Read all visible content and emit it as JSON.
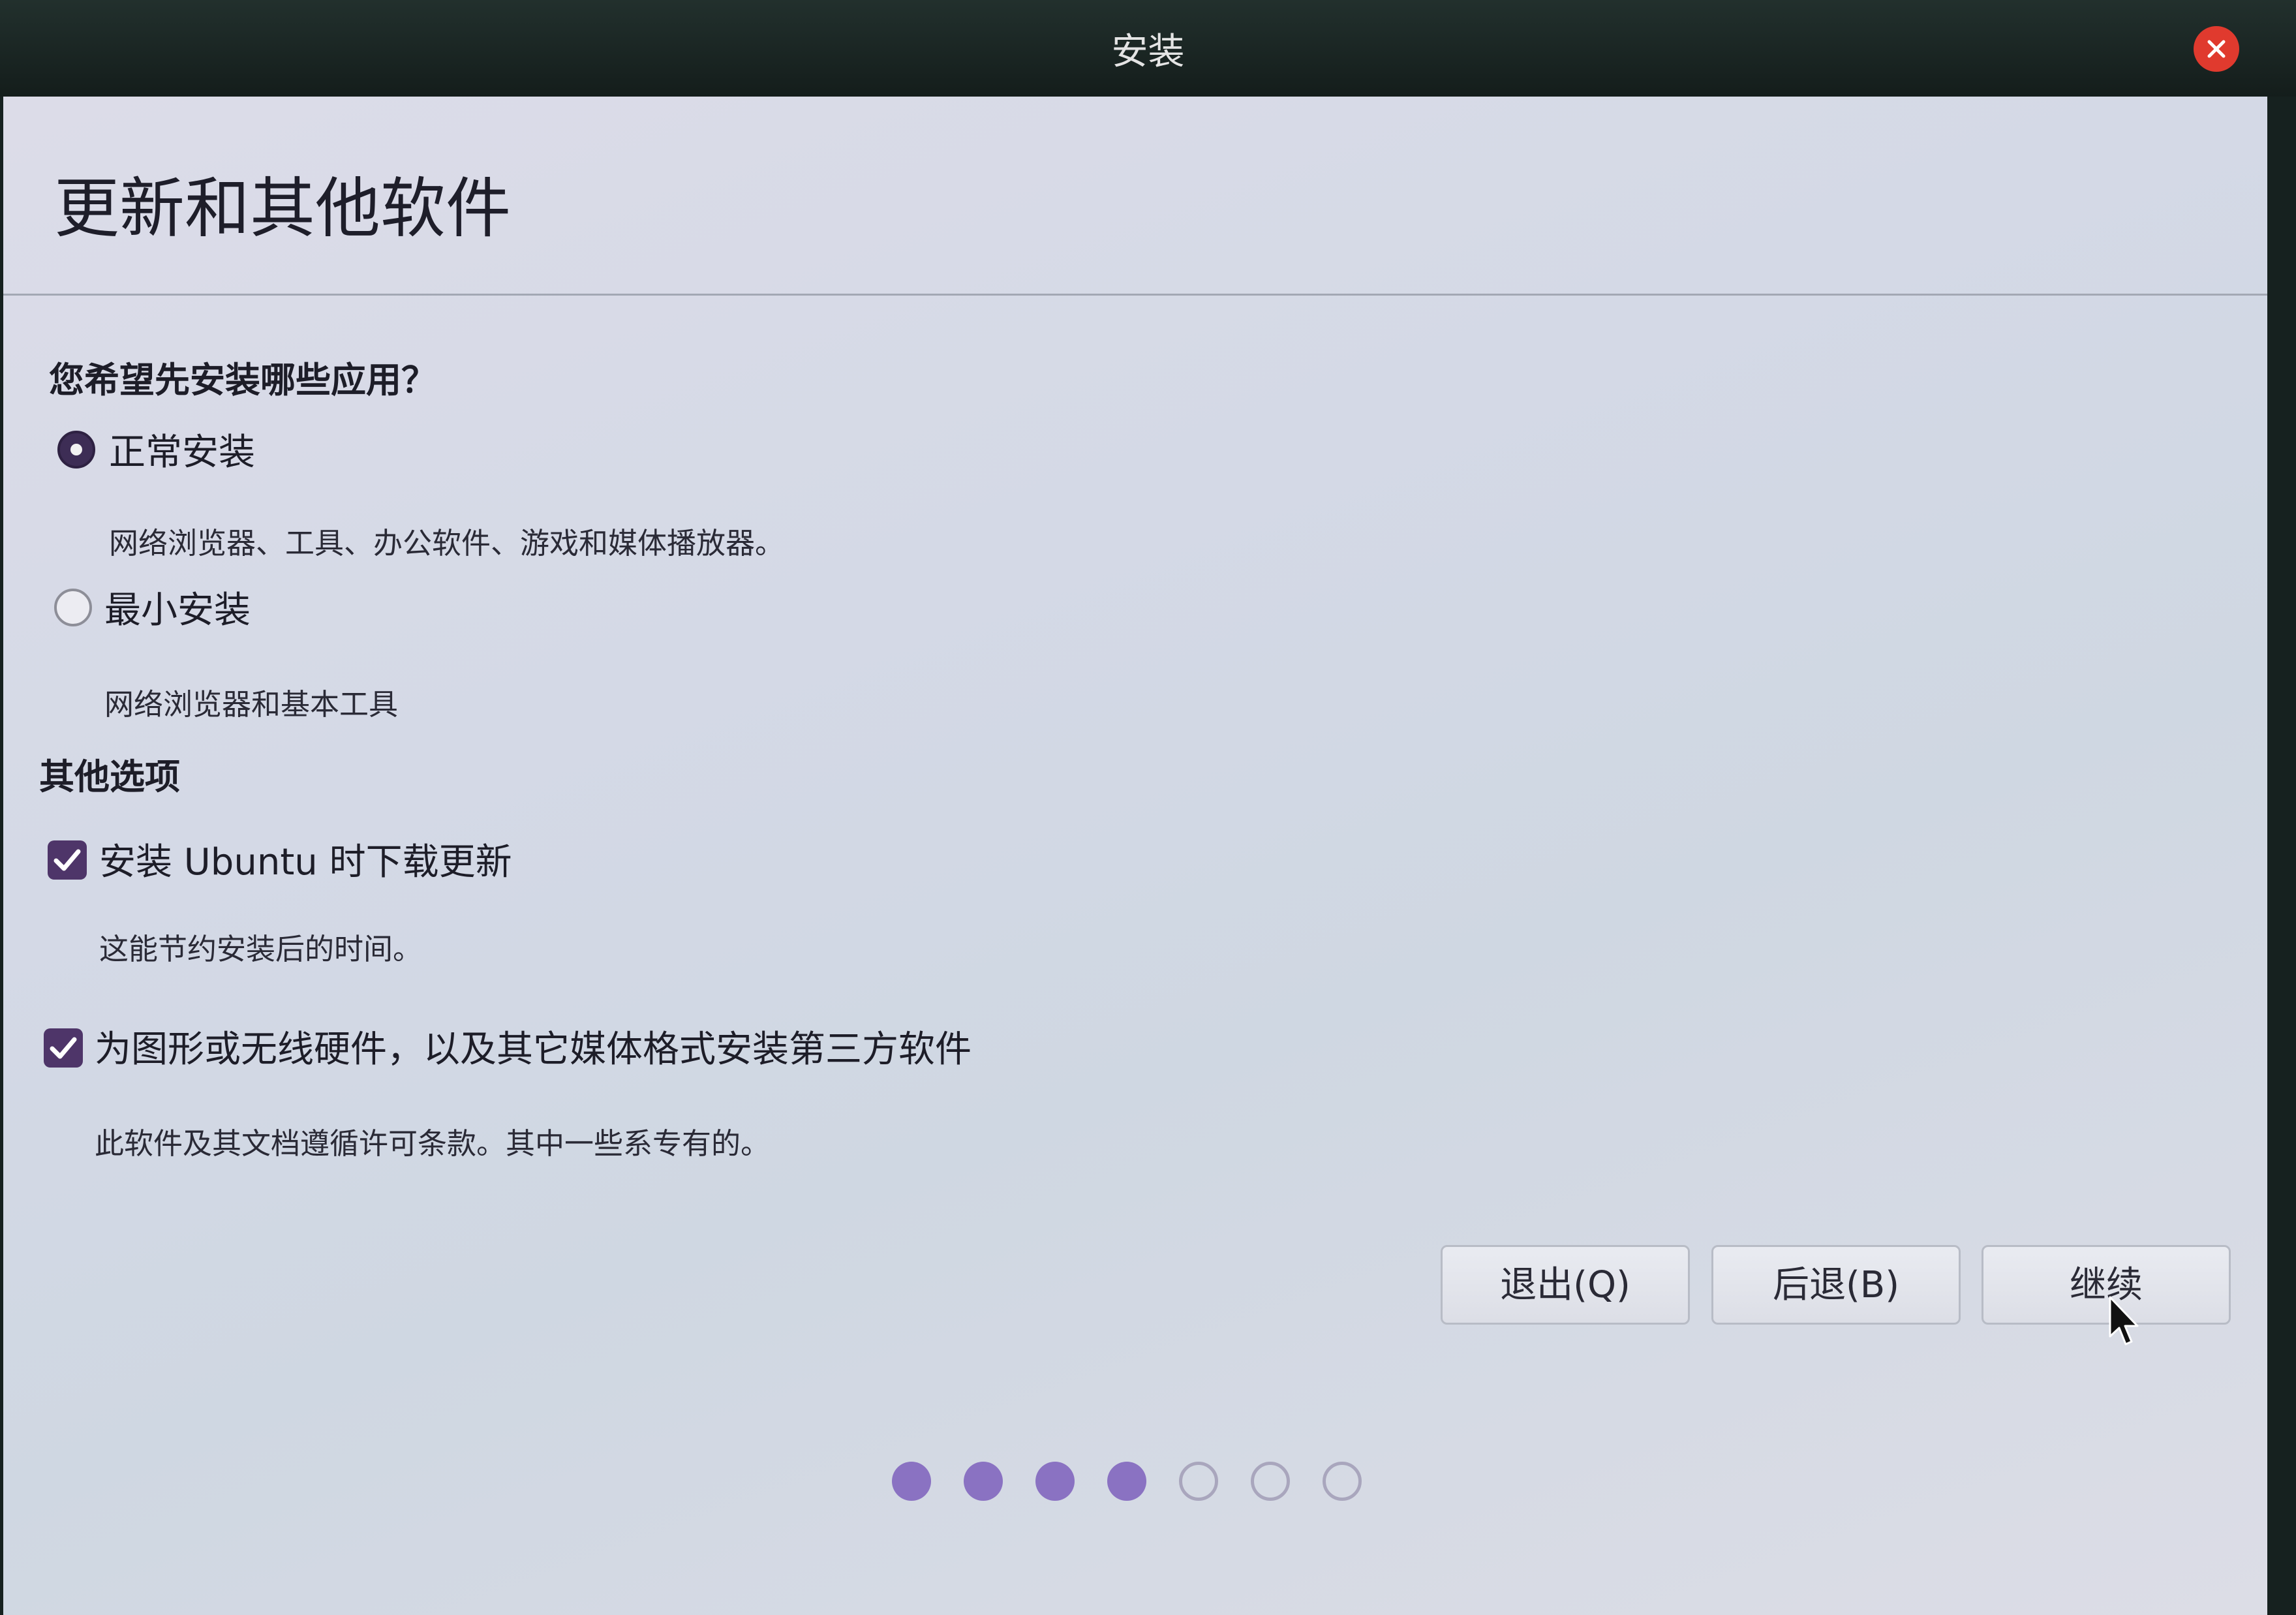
{
  "window": {
    "title": "安装",
    "close_icon": "close-icon"
  },
  "page": {
    "title": "更新和其他软件"
  },
  "install_type": {
    "heading": "您希望先安装哪些应用？",
    "options": [
      {
        "label": "正常安装",
        "description": "网络浏览器、工具、办公软件、游戏和媒体播放器。",
        "selected": true
      },
      {
        "label": "最小安装",
        "description": "网络浏览器和基本工具",
        "selected": false
      }
    ]
  },
  "other_options": {
    "heading": "其他选项",
    "checkboxes": [
      {
        "label": "安装 Ubuntu 时下载更新",
        "description": "这能节约安装后的时间。",
        "checked": true
      },
      {
        "label": "为图形或无线硬件，以及其它媒体格式安装第三方软件",
        "description": "此软件及其文档遵循许可条款。其中一些系专有的。",
        "checked": true
      }
    ]
  },
  "buttons": {
    "quit": "退出(Q)",
    "back": "后退(B)",
    "continue": "继续"
  },
  "progress": {
    "total_steps": 7,
    "completed_steps": 4
  },
  "colors": {
    "accent": "#4e3569",
    "progress_filled": "#8a72c2",
    "close_button": "#e03a2e"
  }
}
